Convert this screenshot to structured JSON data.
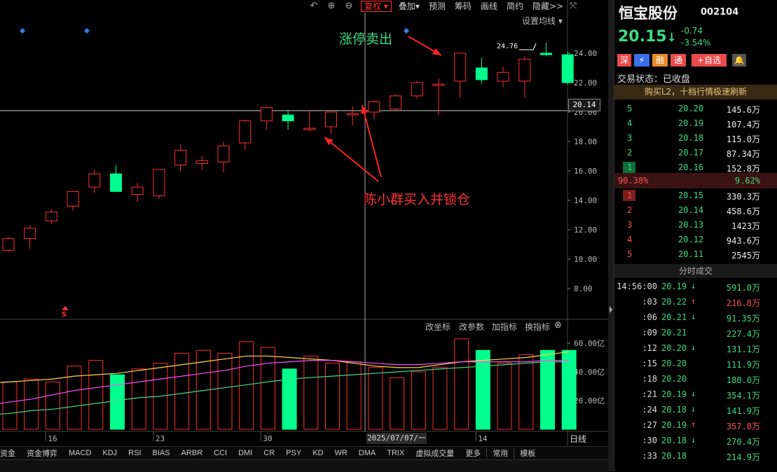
{
  "toolbar": {
    "fq_label": "复权",
    "items": [
      "叠加",
      "预测",
      "筹码",
      "画线",
      "简约",
      "隐藏>>"
    ]
  },
  "chart": {
    "set_ma_label": "设置均线",
    "price_ticks": [
      "24.00",
      "22.00",
      "20.00",
      "18.00",
      "16.00",
      "14.00",
      "12.00",
      "10.00",
      "8.00"
    ],
    "current_price_label": "20.14",
    "max_label": "24.76",
    "annotation_sell": "涨停卖出",
    "annotation_buy": "陈小群买入并锁仓",
    "s_marker": "S",
    "date_ticks": [
      "16",
      "23",
      "30",
      "14"
    ],
    "crosshair_date": "2025/07/07/一",
    "period_label": "日线",
    "volume_ticks": [
      "60.00亿",
      "40.00亿",
      "20.00亿"
    ],
    "sub_controls": [
      "改坐标",
      "改参数",
      "加指标",
      "换指标"
    ],
    "colors": {
      "up": "#ff2d2d",
      "down": "#00ff8c",
      "ma1": "#ffffff",
      "ma2": "#ffd84a",
      "ma3": "#ff4dff",
      "ma4": "#3ddc84"
    }
  },
  "chart_data": {
    "type": "candlestick",
    "price_ylim": [
      8,
      24
    ],
    "candles": [
      {
        "o": 10.6,
        "h": 11.5,
        "l": 10.5,
        "c": 11.4
      },
      {
        "o": 11.4,
        "h": 12.3,
        "l": 10.7,
        "c": 12.1
      },
      {
        "o": 12.6,
        "h": 13.4,
        "l": 12.4,
        "c": 13.2
      },
      {
        "o": 13.6,
        "h": 14.6,
        "l": 13.3,
        "c": 14.6
      },
      {
        "o": 14.9,
        "h": 16.1,
        "l": 14.5,
        "c": 15.8
      },
      {
        "o": 15.8,
        "h": 16.4,
        "l": 14.6,
        "c": 14.6
      },
      {
        "o": 14.4,
        "h": 15.2,
        "l": 13.9,
        "c": 14.9
      },
      {
        "o": 14.3,
        "h": 16.1,
        "l": 14.1,
        "c": 16.1
      },
      {
        "o": 16.4,
        "h": 17.8,
        "l": 16.0,
        "c": 17.4
      },
      {
        "o": 16.5,
        "h": 17.0,
        "l": 16.1,
        "c": 16.7
      },
      {
        "o": 16.6,
        "h": 18.0,
        "l": 15.9,
        "c": 17.7
      },
      {
        "o": 17.9,
        "h": 19.5,
        "l": 17.4,
        "c": 19.4
      },
      {
        "o": 19.4,
        "h": 20.4,
        "l": 18.8,
        "c": 20.3
      },
      {
        "o": 19.8,
        "h": 20.1,
        "l": 18.8,
        "c": 19.4
      },
      {
        "o": 18.8,
        "h": 20.1,
        "l": 18.7,
        "c": 18.9
      },
      {
        "o": 19.0,
        "h": 20.1,
        "l": 18.5,
        "c": 20.0
      },
      {
        "o": 19.9,
        "h": 20.4,
        "l": 19.1,
        "c": 19.9
      },
      {
        "o": 20.0,
        "h": 20.8,
        "l": 19.5,
        "c": 20.7
      },
      {
        "o": 20.2,
        "h": 21.2,
        "l": 20.1,
        "c": 21.1
      },
      {
        "o": 21.1,
        "h": 22.1,
        "l": 20.9,
        "c": 22.0
      },
      {
        "o": 21.8,
        "h": 22.3,
        "l": 19.8,
        "c": 21.9
      },
      {
        "o": 22.1,
        "h": 24.0,
        "l": 21.0,
        "c": 24.0
      },
      {
        "o": 23.0,
        "h": 23.7,
        "l": 21.9,
        "c": 22.2
      },
      {
        "o": 22.1,
        "h": 23.1,
        "l": 21.7,
        "c": 22.7
      },
      {
        "o": 22.1,
        "h": 23.8,
        "l": 21.0,
        "c": 23.6
      },
      {
        "o": 24.0,
        "h": 24.7,
        "l": 23.8,
        "c": 23.9
      },
      {
        "o": 23.9,
        "h": 24.1,
        "l": 21.9,
        "c": 22.0
      }
    ],
    "volume_ylim": [
      0,
      65
    ],
    "volumes": [
      33,
      33,
      35,
      33,
      44,
      48,
      38,
      42,
      46,
      53,
      55,
      53,
      61,
      57,
      42,
      51,
      46,
      47,
      43,
      36,
      40,
      43,
      63,
      55,
      46,
      52,
      55,
      55
    ],
    "vol_ma1": [
      32,
      33,
      34,
      35,
      37,
      38,
      39,
      41,
      43,
      45,
      47,
      49,
      51,
      51,
      50,
      49,
      48,
      46,
      44,
      43,
      43,
      45,
      47,
      48,
      49,
      50,
      52,
      54
    ],
    "vol_ma2": [
      17,
      19,
      21,
      24,
      27,
      29,
      31,
      33,
      35,
      37,
      39,
      41,
      44,
      46,
      47,
      48,
      48,
      47,
      46,
      45,
      45,
      46,
      47,
      47,
      47,
      47,
      48,
      48
    ],
    "vol_ma3": [
      10,
      11,
      13,
      14,
      16,
      18,
      20,
      22,
      23,
      25,
      27,
      29,
      31,
      33,
      35,
      36,
      37,
      38,
      39,
      40,
      41,
      42,
      43,
      44,
      45,
      46,
      47,
      47
    ]
  },
  "indicators": [
    "资金",
    "资金博弈",
    "MACD",
    "KDJ",
    "RSI",
    "BIAS",
    "ARBR",
    "CCI",
    "DMI",
    "CR",
    "PSY",
    "KD",
    "WR",
    "DMA",
    "TRIX",
    "虚拟成交量",
    "更多",
    "常用",
    "模板"
  ],
  "panel": {
    "name": "恒宝股份",
    "code": "002104",
    "price": "20.15",
    "arrow": "↓",
    "change": "-0.74",
    "change_pct": "-3.54%",
    "badges": [
      "深",
      "融",
      "通",
      "+自选"
    ],
    "status": "交易状态：已收盘",
    "l2_banner": "购买L2，十档行情极速刷新",
    "sell_levels": [
      {
        "lv": "5",
        "price": "20.20",
        "vol": "145.6万"
      },
      {
        "lv": "4",
        "price": "20.19",
        "vol": "107.4万"
      },
      {
        "lv": "3",
        "price": "20.18",
        "vol": "115.0万"
      },
      {
        "lv": "2",
        "price": "20.17",
        "vol": "87.34万"
      },
      {
        "lv": "1",
        "price": "20.16",
        "vol": "152.8万"
      }
    ],
    "ratio_left": "90.38%",
    "ratio_right": "9.62%",
    "buy_levels": [
      {
        "lv": "1",
        "price": "20.15",
        "vol": "330.3万"
      },
      {
        "lv": "2",
        "price": "20.14",
        "vol": "458.6万"
      },
      {
        "lv": "3",
        "price": "20.13",
        "vol": "1423万"
      },
      {
        "lv": "4",
        "price": "20.12",
        "vol": "943.6万"
      },
      {
        "lv": "5",
        "price": "20.11",
        "vol": "2545万"
      }
    ],
    "trades_header": "分时成交",
    "trades": [
      {
        "t": "14:56:00",
        "p": "20.19",
        "a": "down",
        "v": "591.0万"
      },
      {
        "t": ":03",
        "p": "20.22",
        "a": "up",
        "v": "216.8万"
      },
      {
        "t": ":06",
        "p": "20.21",
        "a": "down",
        "v": "91.35万"
      },
      {
        "t": ":09",
        "p": "20.21",
        "a": "",
        "v": "227.4万"
      },
      {
        "t": ":12",
        "p": "20.20",
        "a": "down",
        "v": "131.1万"
      },
      {
        "t": ":15",
        "p": "20.20",
        "a": "",
        "v": "111.9万"
      },
      {
        "t": ":18",
        "p": "20.20",
        "a": "",
        "v": "180.0万"
      },
      {
        "t": ":21",
        "p": "20.19",
        "a": "down",
        "v": "354.1万"
      },
      {
        "t": ":24",
        "p": "20.18",
        "a": "down",
        "v": "141.9万"
      },
      {
        "t": ":27",
        "p": "20.19",
        "a": "up",
        "v": "357.8万"
      },
      {
        "t": ":30",
        "p": "20.18",
        "a": "down",
        "v": "270.4万"
      },
      {
        "t": ":33",
        "p": "20.18",
        "a": "",
        "v": "214.9万"
      }
    ]
  }
}
